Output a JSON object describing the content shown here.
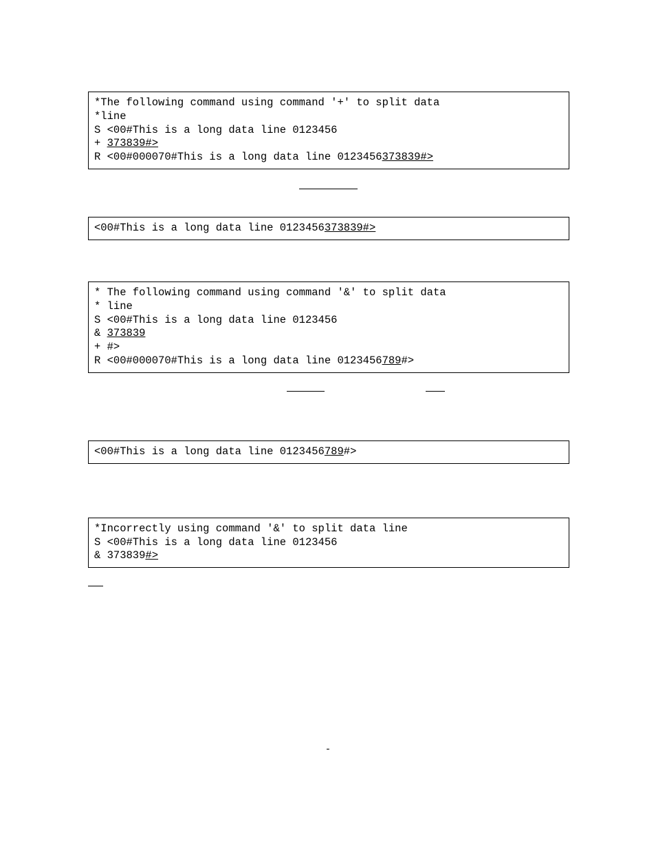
{
  "box1": {
    "l1": "*The following command using command '+' to split data",
    "l2": "*line",
    "l3": "S <00#This is a long data line 0123456",
    "l4a": "+ ",
    "l4u": "373839#>",
    "l5a": "R <00#000070#This is a long data line 0123456",
    "l5u": "373839#>"
  },
  "box2": {
    "l1a": "<00#This is a long data line 0123456",
    "l1u": "373839#>"
  },
  "box3": {
    "l1": "* The following command using command '&' to split data",
    "l2": "* line",
    "l3": "S <00#This is a long data line 0123456",
    "l4a": "& ",
    "l4u": "373839",
    "l5": "+ #>",
    "l6a": "R <00#000070#This is a long data line 0123456",
    "l6u": "789",
    "l6b": "#>"
  },
  "box4": {
    "l1a": "<00#This is a long data line 0123456",
    "l1u": "789",
    "l1b": "#>"
  },
  "box5": {
    "l1": "*Incorrectly using command '&' to split data line",
    "l2": "S <00#This is a long data line 0123456",
    "l3a": "& 373839",
    "l3u": "#>"
  },
  "footer": "-"
}
